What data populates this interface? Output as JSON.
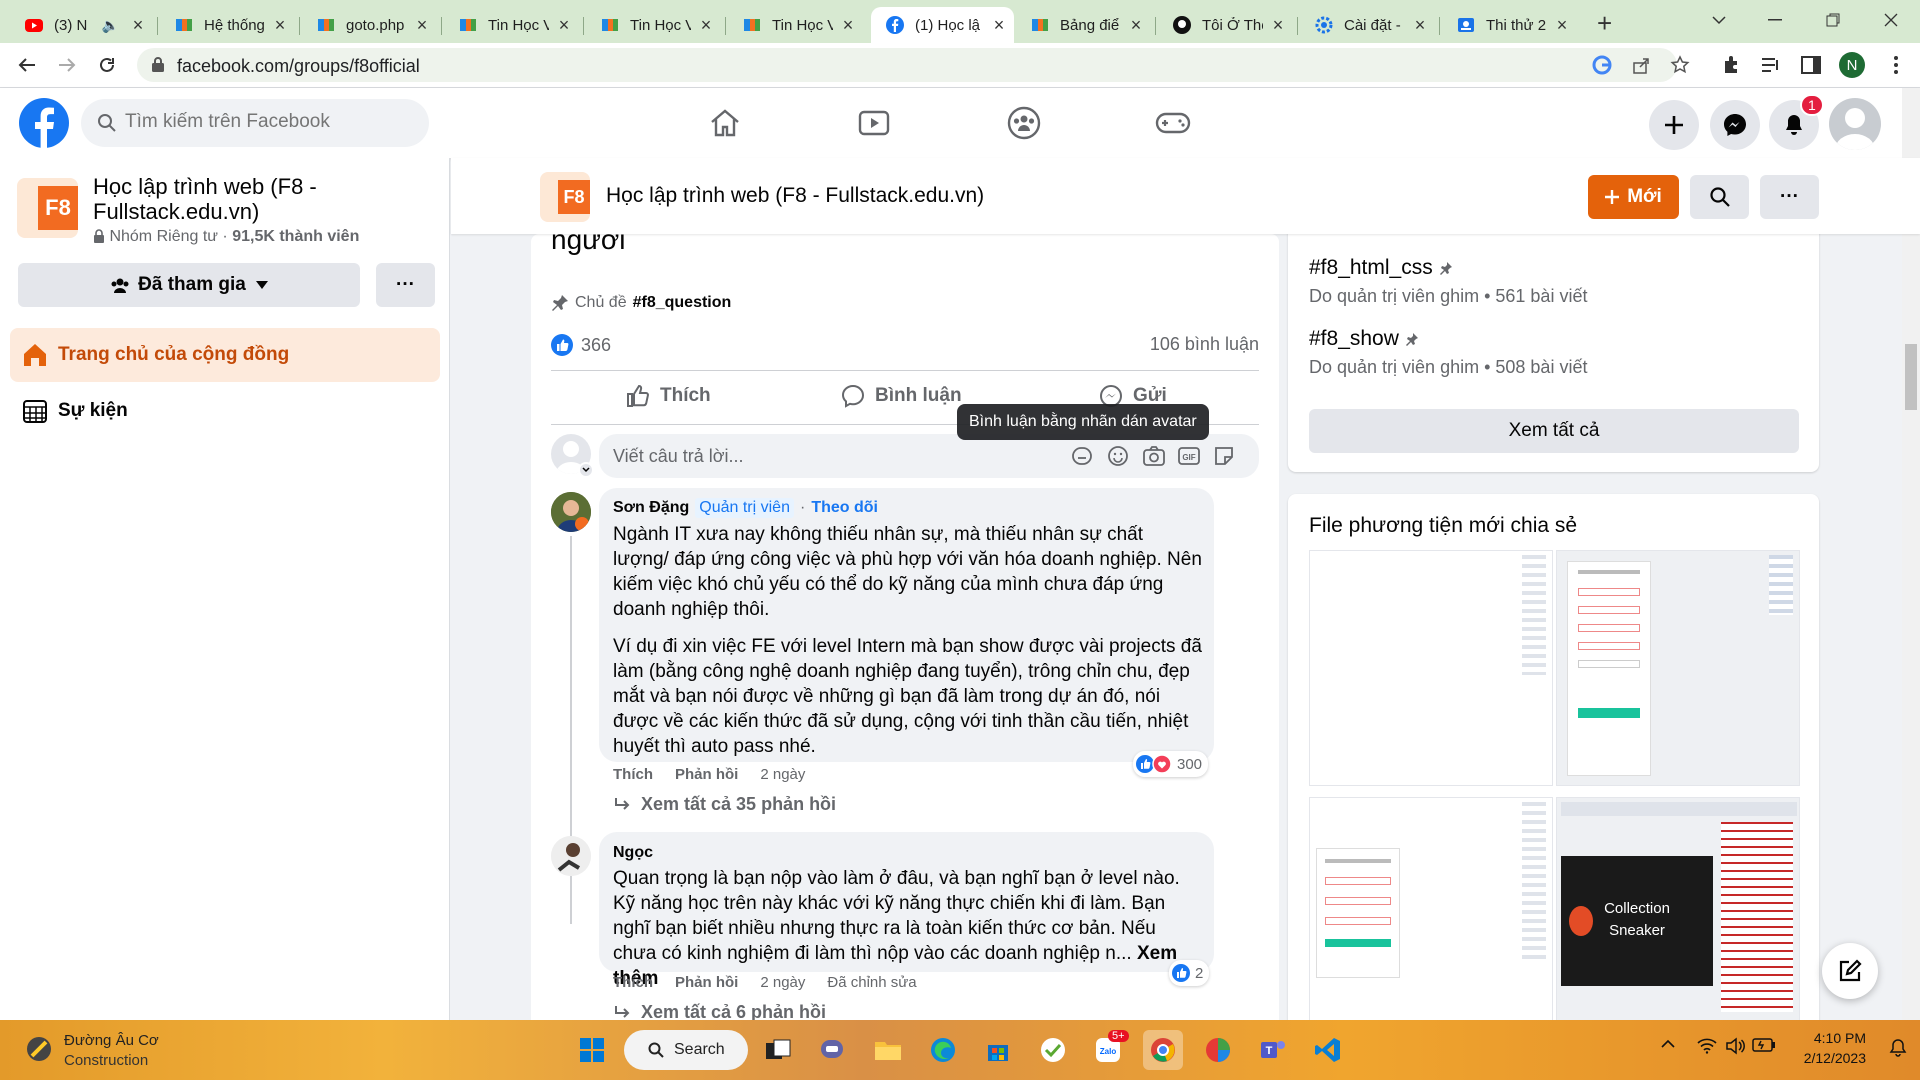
{
  "browser": {
    "tabs": [
      {
        "title": "(3) N",
        "icon": "youtube-icon",
        "color": "#ff0000",
        "audio": true
      },
      {
        "title": "Hệ thống",
        "icon": "fpt-icon",
        "color": "#f37021"
      },
      {
        "title": "goto.php",
        "icon": "fpt-icon",
        "color": "#f37021"
      },
      {
        "title": "Tin Học V",
        "icon": "fpt-icon",
        "color": "#f37021"
      },
      {
        "title": "Tin Học V",
        "icon": "fpt-icon",
        "color": "#f37021"
      },
      {
        "title": "Tin Học V",
        "icon": "fpt-icon",
        "color": "#f37021"
      },
      {
        "title": "(1) Học lậ",
        "icon": "facebook-icon",
        "color": "#1877f2",
        "active": true
      },
      {
        "title": "Bảng điể",
        "icon": "fpt-icon",
        "color": "#f37021"
      },
      {
        "title": "Tôi Ở Thế",
        "icon": "github-icon",
        "color": "#000000"
      },
      {
        "title": "Cài đặt -",
        "icon": "settings-icon",
        "color": "#1a73e8"
      },
      {
        "title": "Thi thử 2",
        "icon": "contact-icon",
        "color": "#1a73e8"
      }
    ],
    "url": "facebook.com/groups/f8official",
    "profile_initial": "N"
  },
  "fb": {
    "search_placeholder": "Tìm kiếm trên Facebook",
    "notification_count": "1",
    "brand_color": "#1877f2"
  },
  "group": {
    "name": "Học lập trình web (F8 - Fullstack.edu.vn)",
    "privacy": "Nhóm Riêng tư",
    "members": "91,5K thành viên",
    "joined_label": "Đã tham gia",
    "more_label": "···",
    "nav": [
      {
        "label": "Trang chủ của cộng đồng",
        "icon": "home-icon",
        "active": true
      },
      {
        "label": "Sự kiện",
        "icon": "calendar-icon",
        "active": false
      }
    ],
    "sticky_title": "Học lập trình web (F8 - Fullstack.edu.vn)",
    "new_button": "Mới",
    "accent": "#e4620b"
  },
  "post": {
    "title_tail": "người",
    "topic_label": "Chủ đề",
    "topic_tag": "#f8_question",
    "like_count": "366",
    "comment_count": "106 bình luận",
    "actions": {
      "like": "Thích",
      "comment": "Bình luận",
      "send": "Gửi"
    },
    "tooltip": "Bình luận bằng nhãn dán avatar",
    "reply_placeholder": "Viết câu trả lời...",
    "comments": [
      {
        "name": "Sơn Đặng",
        "badge": "Quản trị viên",
        "follow": "Theo dõi",
        "paragraphs": [
          "Ngành IT xưa nay không thiếu nhân sự, mà thiếu nhân sự chất lượng/ đáp ứng công việc và phù hợp với văn hóa doanh nghiệp. Nên kiếm việc khó chủ yếu có thể do kỹ năng của mình chưa đáp ứng doanh nghiệp thôi.",
          "Ví dụ đi xin việc FE với level Intern mà bạn show được vài projects đã làm (bằng công nghệ doanh nghiệp đang tuyển), trông chỉn chu, đẹp mắt và bạn nói được về những gì bạn đã làm trong dự án đó, nói được về các kiến thức đã sử dụng, cộng với tinh thần cầu tiến, nhiệt huyết thì auto pass nhé."
        ],
        "like": "Thích",
        "reply": "Phản hồi",
        "time": "2 ngày",
        "reactions": "300",
        "view_replies": "Xem tất cả 35 phản hồi"
      },
      {
        "name": "Ngọc",
        "text": "Quan trọng là bạn nộp vào làm ở đâu, và bạn nghĩ bạn ở level nào. Kỹ năng học trên này khác với kỹ năng thực chiến khi đi làm. Bạn nghĩ bạn biết nhiều nhưng thực ra là toàn kiến thức cơ bản. Nếu chưa có kinh nghiệm đi làm thì nộp vào các doanh nghiệp n...",
        "see_more": "Xem thêm",
        "like": "Thích",
        "reply": "Phản hồi",
        "time": "2 ngày",
        "edited": "Đã chỉnh sửa",
        "reactions": "2",
        "view_replies": "Xem tất cả 6 phản hồi"
      }
    ]
  },
  "right": {
    "topics": [
      {
        "tag": "#f8_html_css",
        "meta": "Do quản trị viên ghim • 561 bài viết"
      },
      {
        "tag": "#f8_show",
        "meta": "Do quản trị viên ghim • 508 bài viết"
      }
    ],
    "see_all": "Xem tất cả",
    "media_title": "File phương tiện mới chia sẻ",
    "media_caption_1": "Collection",
    "media_caption_2": "Sneaker"
  },
  "taskbar": {
    "weather_title": "Đường Âu Cơ",
    "weather_sub": "Construction",
    "search_label": "Search",
    "time": "4:10 PM",
    "date": "2/12/2023",
    "zalo_badge": "5+"
  }
}
